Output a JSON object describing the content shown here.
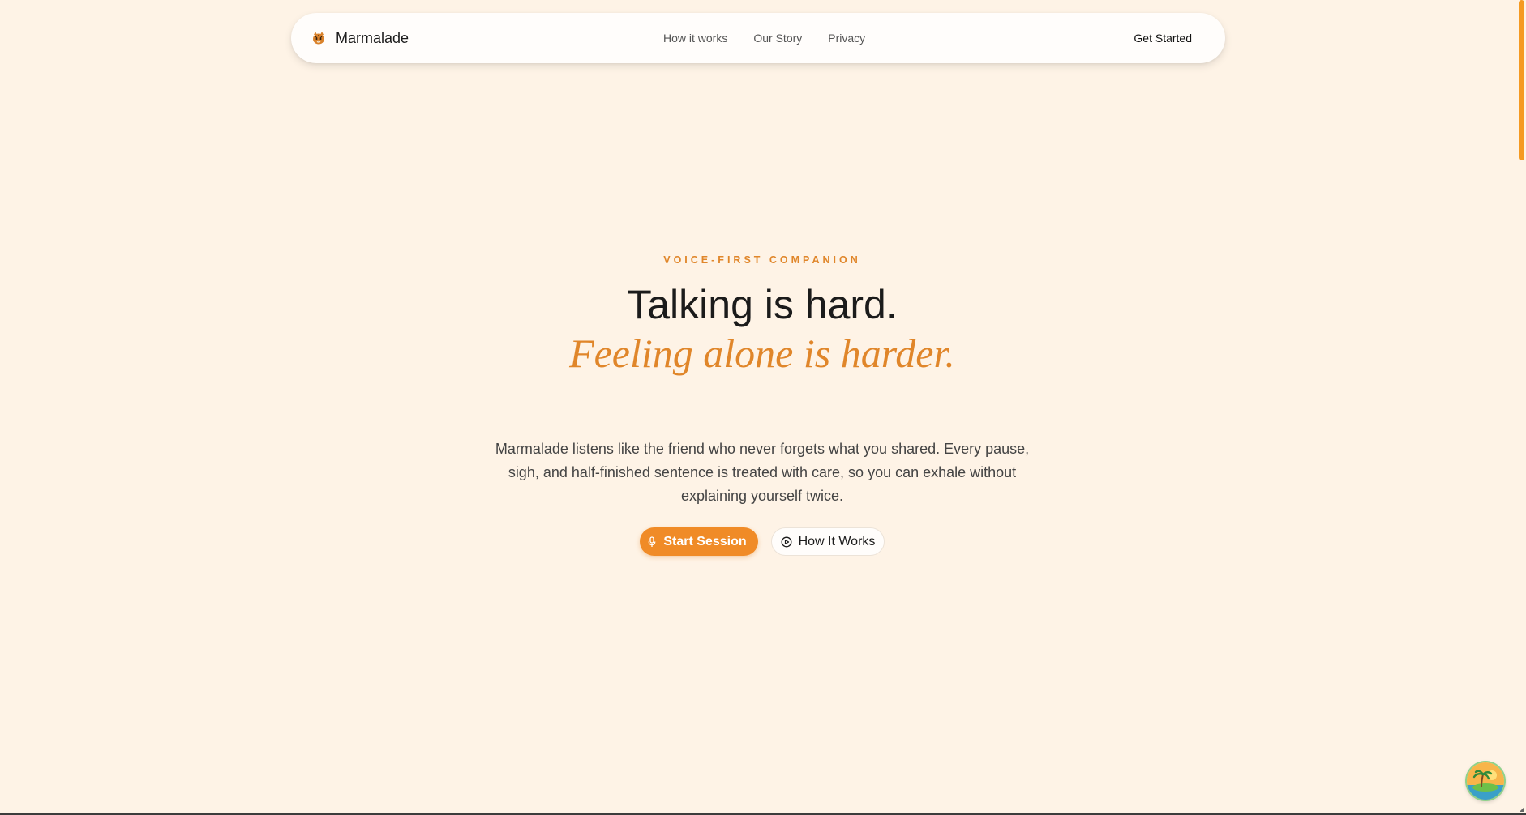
{
  "nav": {
    "brand": "Marmalade",
    "brand_icon": "tiger-logo-icon",
    "links": [
      "How it works",
      "Our Story",
      "Privacy"
    ],
    "cta": "Get Started"
  },
  "hero": {
    "eyebrow": "VOICE-FIRST COMPANION",
    "headline": "Talking is hard.",
    "subheadline": "Feeling alone is harder.",
    "description": "Marmalade listens like the friend who never forgets what you shared. Every pause, sigh, and half-finished sentence is treated with care, so you can exhale without explaining yourself twice.",
    "primary_button": "Start Session",
    "primary_icon": "microphone-icon",
    "secondary_button": "How It Works",
    "secondary_icon": "play-circle-icon"
  },
  "widget": {
    "icon": "island-palm-icon"
  },
  "colors": {
    "background": "#fef3e6",
    "accent": "#e0862a",
    "button": "#f08b27",
    "scrollbar": "#f59a22",
    "text": "#1b1b1b"
  }
}
